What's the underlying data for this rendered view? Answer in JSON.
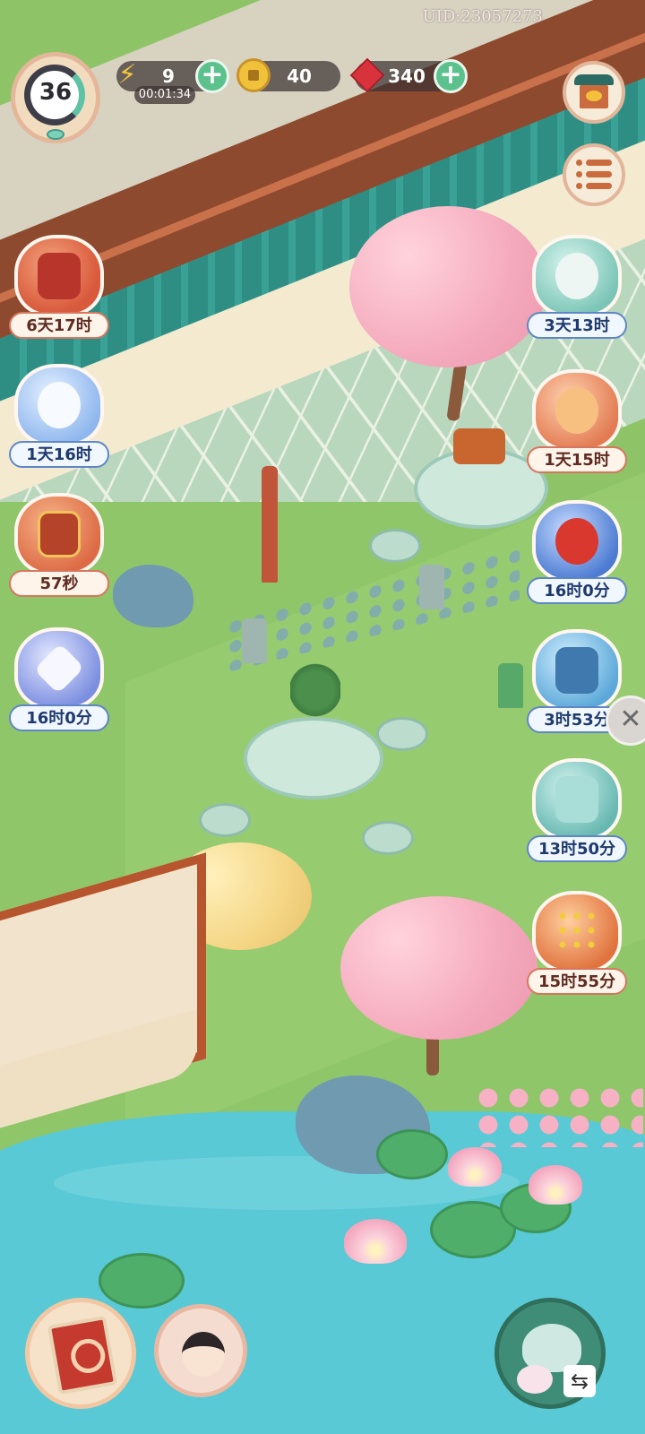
{
  "hud": {
    "uid": "UID:23057273",
    "level": "36",
    "energy": {
      "value": "9",
      "timer": "00:01:34",
      "icon": "lightning-icon"
    },
    "coins": {
      "value": "40",
      "icon": "coin-icon"
    },
    "gems": {
      "value": "340",
      "icon": "ruby-icon"
    },
    "plus_label": "+"
  },
  "right_buttons": [
    {
      "name": "shop",
      "icon": "shop-icon"
    },
    {
      "name": "menu",
      "icon": "list-icon"
    }
  ],
  "left_events": [
    {
      "timer": "6天17时",
      "icon": "autumn-book-icon"
    },
    {
      "timer": "1天16时",
      "icon": "snow-cat-icon"
    },
    {
      "timer": "57秒",
      "icon": "treasure-chest-icon"
    },
    {
      "timer": "16时0分",
      "icon": "kite-icon"
    }
  ],
  "right_events": [
    {
      "timer": "3天13时",
      "icon": "sleeping-cat-icon"
    },
    {
      "timer": "1天15时",
      "icon": "fox-icon"
    },
    {
      "timer": "16时0分",
      "icon": "fan-icon"
    },
    {
      "timer": "3时53分",
      "icon": "map-icon"
    },
    {
      "timer": "13时50分",
      "icon": "gift-cat-icon"
    },
    {
      "timer": "15时55分",
      "icon": "coin-board-icon"
    }
  ],
  "side_close": "✕",
  "bottom": {
    "book": "book-icon",
    "portrait": "character-portrait",
    "teapot": "teapot-icon",
    "swap_label": "⇆"
  },
  "colors": {
    "lawn": "#8fc66a",
    "pond": "#58c9d5",
    "wall": "#8e4a2f",
    "badge_warm_border": "#d7765f",
    "badge_cool_border": "#5f86c6"
  }
}
